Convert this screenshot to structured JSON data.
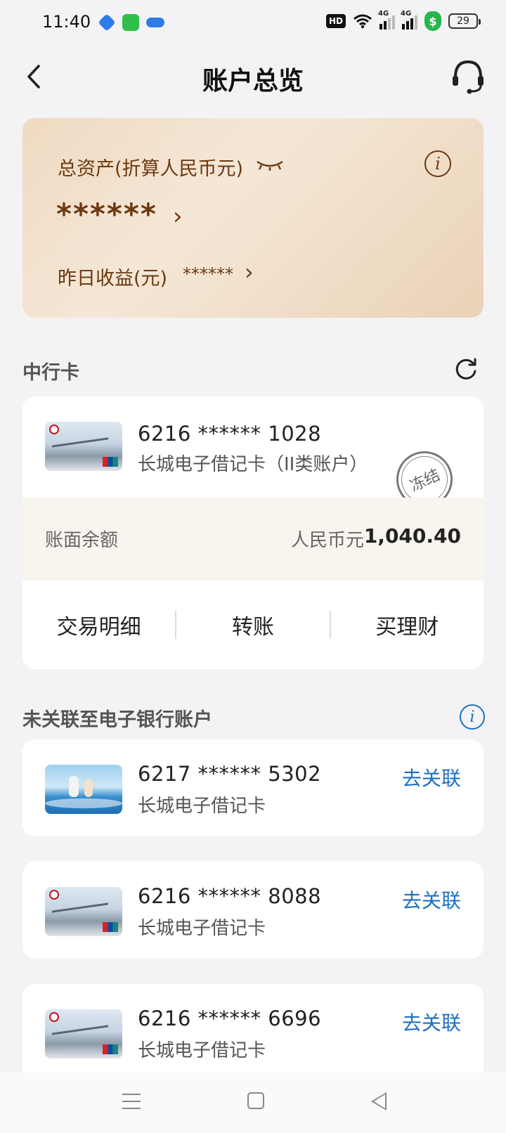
{
  "status_bar": {
    "time": "11:40",
    "battery": "29",
    "network_a": "4G",
    "network_b": "4G",
    "hd_badge": "HD",
    "security_badge": "$"
  },
  "header": {
    "back_icon": "chevron-left-icon",
    "title": "账户总览",
    "service_icon": "headset-icon"
  },
  "asset_card": {
    "total_label": "总资产(折算人民币元)",
    "total_value": "******",
    "yesterday_label": "昨日收益(元)",
    "yesterday_value": "******",
    "info_glyph": "i",
    "chevron": "›"
  },
  "boc_section": {
    "title": "中行卡",
    "refresh_icon": "refresh-icon",
    "card": {
      "number": "6216 ****** 1028",
      "type": "长城电子借记卡（II类账户）",
      "stamp": "冻结",
      "balance_label": "账面余额",
      "currency": "人民币元",
      "balance": "1,040.40",
      "actions": [
        "交易明细",
        "转账",
        "买理财"
      ]
    }
  },
  "unlinked_section": {
    "title": "未关联至电子银行账户",
    "info_glyph": "i",
    "cards": [
      {
        "number": "6217 ****** 5302",
        "type": "长城电子借记卡",
        "action": "去关联"
      },
      {
        "number": "6216 ****** 8088",
        "type": "长城电子借记卡",
        "action": "去关联"
      },
      {
        "number": "6216 ****** 6696",
        "type": "长城电子借记卡",
        "action": "去关联"
      }
    ]
  },
  "nav_bar": {
    "items": [
      "menu-icon",
      "home-icon",
      "back-icon"
    ]
  },
  "colors": {
    "accent": "#1d6fc2",
    "asset_text": "#6b3a12",
    "secure_green": "#28b54d"
  }
}
